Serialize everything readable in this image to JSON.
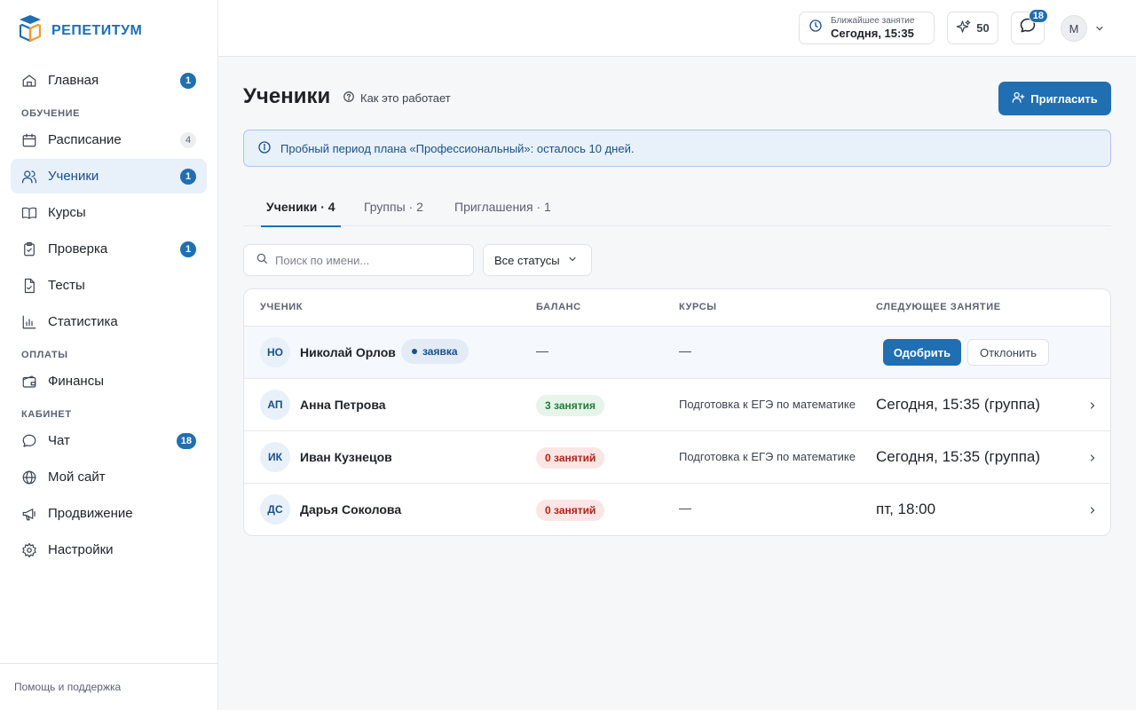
{
  "app": {
    "name": "РЕПЕТИТУМ"
  },
  "sidebar": {
    "items": [
      {
        "label": "Главная",
        "badge": "1"
      },
      {
        "section": "ОБУЧЕНИЕ"
      },
      {
        "label": "Расписание",
        "badge": "4"
      },
      {
        "label": "Ученики",
        "badge": "1",
        "active": true
      },
      {
        "label": "Курсы"
      },
      {
        "label": "Проверка",
        "badge": "1"
      },
      {
        "label": "Тесты"
      },
      {
        "label": "Статистика"
      },
      {
        "section": "ОПЛАТЫ"
      },
      {
        "label": "Финансы"
      },
      {
        "section": "КАБИНЕТ"
      },
      {
        "label": "Чат",
        "badge": "18"
      },
      {
        "label": "Мой сайт"
      },
      {
        "label": "Продвижение"
      },
      {
        "label": "Настройки"
      }
    ],
    "help": "Помощь и поддержка"
  },
  "topbar": {
    "next_lesson_label": "Ближайшее занятие",
    "next_lesson_value": "Сегодня, 15:35",
    "points": "50",
    "chat_badge": "18",
    "user_initial": "М"
  },
  "page": {
    "title": "Ученики",
    "how_it_works": "Как это работает",
    "invite": "Пригласить",
    "trial_banner": "Пробный период плана «Профессиональный»: осталось 10 дней."
  },
  "tabs": [
    {
      "label": "Ученики · 4",
      "active": true
    },
    {
      "label": "Группы · 2"
    },
    {
      "label": "Приглашения · 1"
    }
  ],
  "filters": {
    "search_placeholder": "Поиск по имени...",
    "status": "Все статусы"
  },
  "table": {
    "columns": [
      "УЧЕНИК",
      "БАЛАНС",
      "КУРСЫ",
      "СЛЕДУЮЩЕЕ ЗАНЯТИЕ"
    ],
    "pending": {
      "initials": "НО",
      "name": "Николай Орлов",
      "badge": "заявка",
      "balance": "—",
      "course": "—",
      "approve": "Одобрить",
      "reject": "Отклонить"
    },
    "rows": [
      {
        "initials": "АП",
        "name": "Анна Петрова",
        "balance": "3 занятия",
        "balance_status": "ok",
        "course": "Подготовка к ЕГЭ по математике",
        "next": "Сегодня, 15:35 (группа)"
      },
      {
        "initials": "ИК",
        "name": "Иван Кузнецов",
        "balance": "0 занятий",
        "balance_status": "zero",
        "course": "Подготовка к ЕГЭ по математике",
        "next": "Сегодня, 15:35 (группа)"
      },
      {
        "initials": "ДС",
        "name": "Дарья Соколова",
        "balance": "0 занятий",
        "balance_status": "zero",
        "course": "—",
        "next": "пт, 18:00"
      }
    ]
  },
  "colors": {
    "accent": "#1f6fb2",
    "accent_light": "#e8f0fa",
    "success": "#237a3b",
    "danger": "#b42318"
  }
}
